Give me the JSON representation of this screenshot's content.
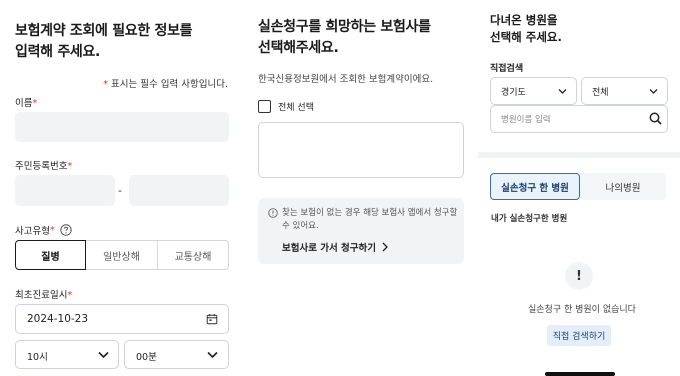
{
  "left_panel": {
    "title_line1": "보험계약 조회에 필요한 정보를",
    "title_line2": "입력해 주세요.",
    "required_note": "표시는 필수 입력 사항입니다.",
    "required_mark": "*",
    "name_label": "이름",
    "rrn_label": "주민등록번호",
    "rrn_separator": "-",
    "accident_type_label": "사고유형",
    "accident_types": [
      "질병",
      "일반상해",
      "교통상해"
    ],
    "first_visit_label": "최초진료일시",
    "first_visit_date": "2024-10-23",
    "hour_value": "10시",
    "minute_value": "00분"
  },
  "middle_panel": {
    "title_line1": "실손청구를 희망하는 보험사를",
    "title_line2": "선택해주세요.",
    "subtitle": "한국신용정보원에서 조회한 보험계약이에요.",
    "select_all_label": "전체 선택",
    "info_line1": "찾는 보험이 없는 경우 해당 보험사 앱에서 청구할",
    "info_line2": "수 있어요.",
    "insurer_link": "보험사로 가서 청구하기"
  },
  "right_panel": {
    "title_line1": "다녀온 병원을",
    "title_line2": "선택해 주세요.",
    "direct_search_label": "직접검색",
    "region_value": "경기도",
    "district_value": "전체",
    "hospital_search_placeholder": "병원이름 입력",
    "tabs": [
      "실손청구 한 병원",
      "나의병원"
    ],
    "claimed_hospitals_label": "내가 실손청구한 병원",
    "empty_icon": "!",
    "empty_message": "실손청구 한 병원이 없습니다",
    "direct_search_button": "직접 검색하기"
  },
  "icons": {
    "help": "question-circle-icon",
    "calendar": "calendar-icon",
    "chevron": "chevron-down-icon",
    "search": "search-icon",
    "info": "info-circle-icon",
    "arrow": "chevron-right-icon"
  }
}
